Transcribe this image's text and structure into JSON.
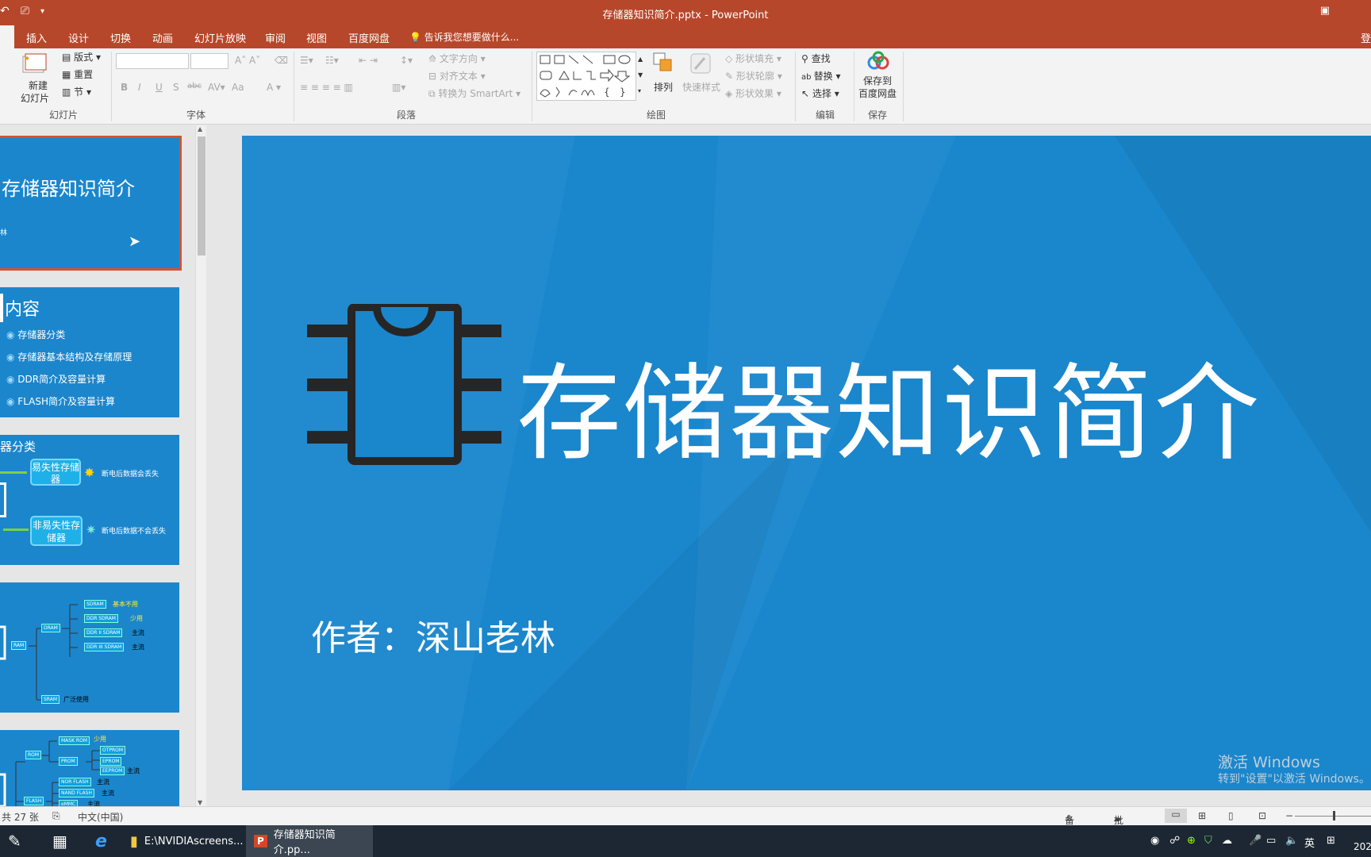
{
  "window": {
    "title": "存储器知识简介.pptx - PowerPoint"
  },
  "tabs": {
    "items": [
      "插入",
      "设计",
      "切换",
      "动画",
      "幻灯片放映",
      "审阅",
      "视图",
      "百度网盘"
    ],
    "tell_me": "告诉我您想要做什么...",
    "login": "登"
  },
  "ribbon": {
    "groups": {
      "slides": "幻灯片",
      "font": "字体",
      "paragraph": "段落",
      "drawing": "绘图",
      "editing": "编辑",
      "save": "保存"
    },
    "new_slide_line1": "新建",
    "new_slide_line2": "幻灯片",
    "layout": "版式",
    "reset": "重置",
    "section": "节",
    "font_bold": "B",
    "font_italic": "I",
    "font_underline": "U",
    "font_shadow": "S",
    "font_strike": "abc",
    "font_case": "Aa",
    "text_direction": "文字方向",
    "align_text": "对齐文本",
    "convert_smartart": "转换为 SmartArt",
    "arrange": "排列",
    "quick_styles": "快速样式",
    "shape_fill": "形状填充",
    "shape_outline": "形状轮廓",
    "shape_effects": "形状效果",
    "find": "查找",
    "replace": "替换",
    "select": "选择",
    "save_baidu_line1": "保存到",
    "save_baidu_line2": "百度网盘"
  },
  "thumbnails": {
    "slide1": {
      "title": "存储器知识简介",
      "author_fragment": "林"
    },
    "slide2": {
      "title": "内容",
      "items": [
        "存储器分类",
        "存储器基本结构及存储原理",
        "DDR简介及容量计算",
        "FLASH简介及容量计算"
      ]
    },
    "slide3": {
      "title": "器分类",
      "box1": "易失性存储器",
      "box2": "非易失性存储器",
      "note1": "断电后数据会丢失",
      "note2": "断电后数据不会丢失"
    },
    "slide4": {
      "ram": "RAM",
      "dram": "DRAM",
      "sram": "SRAM",
      "sdram": "SDRAM",
      "ddr_sdram": "DDR SDRAM",
      "ddr2": "DDR II SDRAM",
      "ddr3": "DDR III SDRAM",
      "note_sdram": "基本不用",
      "note_ddr": "少用",
      "note_ddr2": "主流",
      "note_ddr3": "主流",
      "note_sram": "广泛使用"
    },
    "slide5": {
      "rom": "ROM",
      "mask": "MASK ROM",
      "prom": "PROM",
      "otprom": "OTPROM",
      "eprom": "EPROM",
      "eeprom": "EEPROM",
      "flash": "FLASH",
      "nor": "NOR FLASH",
      "nand": "NAND FLASH",
      "emmc": "eMMC",
      "note_mask": "少用",
      "note_main": "主流"
    }
  },
  "slide": {
    "title": "存储器知识简介",
    "author": "作者：深山老林"
  },
  "activation": {
    "line1": "激活 Windows",
    "line2": "转到\"设置\"以激活 Windows。"
  },
  "status": {
    "slide_count": "共 27 张",
    "language": "中文(中国)",
    "notes": "备注",
    "comments": "批注"
  },
  "taskbar": {
    "explorer": "E:\\NVIDIAscreens...",
    "powerpoint": "存储器知识简介.pp...",
    "ime": "英",
    "clock_fragment": "202"
  },
  "colors": {
    "accent": "#b7472a",
    "slide_blue": "#1a86cc",
    "selection": "#d35230"
  }
}
